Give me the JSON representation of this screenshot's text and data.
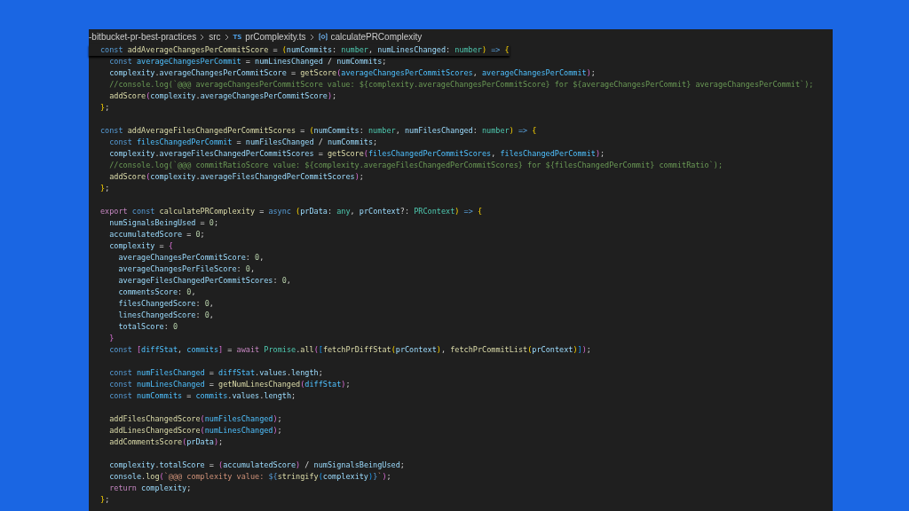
{
  "breadcrumbs": [
    {
      "label": "-bitbucket-pr-best-practices",
      "kind": "folder"
    },
    {
      "label": "src",
      "kind": "folder"
    },
    {
      "label": "prComplexity.ts",
      "kind": "file",
      "icon_text": "TS"
    },
    {
      "label": "calculatePRComplexity",
      "kind": "symbol"
    }
  ],
  "sticky_line": [
    {
      "text": "const ",
      "kind": "kw"
    },
    {
      "text": "addAverageChangesPerCommitScore",
      "kind": "fn"
    },
    {
      "text": " = ",
      "kind": "p"
    },
    {
      "text": "(",
      "kind": "b1"
    },
    {
      "text": "numCommits",
      "kind": "var"
    },
    {
      "text": ": ",
      "kind": "p"
    },
    {
      "text": "number",
      "kind": "type"
    },
    {
      "text": ", ",
      "kind": "p"
    },
    {
      "text": "numLinesChanged",
      "kind": "var"
    },
    {
      "text": ": ",
      "kind": "p"
    },
    {
      "text": "number",
      "kind": "type"
    },
    {
      "text": ")",
      "kind": "b1"
    },
    {
      "text": " => ",
      "kind": "kw"
    },
    {
      "text": "{",
      "kind": "b1"
    }
  ],
  "blocks": [
    [
      [
        {
          "text": "  const ",
          "kind": "kw"
        },
        {
          "text": "averageChangesPerCommit",
          "kind": "cvar"
        },
        {
          "text": " = ",
          "kind": "p"
        },
        {
          "text": "numLinesChanged",
          "kind": "var"
        },
        {
          "text": " / ",
          "kind": "p"
        },
        {
          "text": "numCommits",
          "kind": "var"
        },
        {
          "text": ";",
          "kind": "p"
        }
      ],
      [
        {
          "text": "  complexity",
          "kind": "var"
        },
        {
          "text": ".",
          "kind": "p"
        },
        {
          "text": "averageChangesPerCommitScore",
          "kind": "var"
        },
        {
          "text": " = ",
          "kind": "p"
        },
        {
          "text": "getScore",
          "kind": "fn"
        },
        {
          "text": "(",
          "kind": "b2"
        },
        {
          "text": "averageChangesPerCommitScores",
          "kind": "cvar"
        },
        {
          "text": ", ",
          "kind": "p"
        },
        {
          "text": "averageChangesPerCommit",
          "kind": "cvar"
        },
        {
          "text": ")",
          "kind": "b2"
        },
        {
          "text": ";",
          "kind": "p"
        }
      ],
      [
        {
          "text": "  //console.log(`@@@ averageChangesPerCommitScore value: ${complexity.averageChangesPerCommitScore} for ${averageChangesPerCommit} averageChangesPerCommit`);",
          "kind": "cm"
        }
      ],
      [
        {
          "text": "  addScore",
          "kind": "fn"
        },
        {
          "text": "(",
          "kind": "b2"
        },
        {
          "text": "complexity",
          "kind": "var"
        },
        {
          "text": ".",
          "kind": "p"
        },
        {
          "text": "averageChangesPerCommitScore",
          "kind": "var"
        },
        {
          "text": ")",
          "kind": "b2"
        },
        {
          "text": ";",
          "kind": "p"
        }
      ],
      [
        {
          "text": "}",
          "kind": "b1"
        },
        {
          "text": ";",
          "kind": "p"
        }
      ]
    ],
    [
      [
        {
          "text": "const ",
          "kind": "kw"
        },
        {
          "text": "addAverageFilesChangedPerCommitScores",
          "kind": "fn"
        },
        {
          "text": " = ",
          "kind": "p"
        },
        {
          "text": "(",
          "kind": "b1"
        },
        {
          "text": "numCommits",
          "kind": "var"
        },
        {
          "text": ": ",
          "kind": "p"
        },
        {
          "text": "number",
          "kind": "type"
        },
        {
          "text": ", ",
          "kind": "p"
        },
        {
          "text": "numFilesChanged",
          "kind": "var"
        },
        {
          "text": ": ",
          "kind": "p"
        },
        {
          "text": "number",
          "kind": "type"
        },
        {
          "text": ")",
          "kind": "b1"
        },
        {
          "text": " => ",
          "kind": "kw"
        },
        {
          "text": "{",
          "kind": "b1"
        }
      ],
      [
        {
          "text": "  const ",
          "kind": "kw"
        },
        {
          "text": "filesChangedPerCommit",
          "kind": "cvar"
        },
        {
          "text": " = ",
          "kind": "p"
        },
        {
          "text": "numFilesChanged",
          "kind": "var"
        },
        {
          "text": " / ",
          "kind": "p"
        },
        {
          "text": "numCommits",
          "kind": "var"
        },
        {
          "text": ";",
          "kind": "p"
        }
      ],
      [
        {
          "text": "  complexity",
          "kind": "var"
        },
        {
          "text": ".",
          "kind": "p"
        },
        {
          "text": "averageFilesChangedPerCommitScores",
          "kind": "var"
        },
        {
          "text": " = ",
          "kind": "p"
        },
        {
          "text": "getScore",
          "kind": "fn"
        },
        {
          "text": "(",
          "kind": "b2"
        },
        {
          "text": "filesChangedPerCommitScores",
          "kind": "cvar"
        },
        {
          "text": ", ",
          "kind": "p"
        },
        {
          "text": "filesChangedPerCommit",
          "kind": "cvar"
        },
        {
          "text": ")",
          "kind": "b2"
        },
        {
          "text": ";",
          "kind": "p"
        }
      ],
      [
        {
          "text": "  //console.log(`@@@ commitRatioScore value: ${complexity.averageFilesChangedPerCommitScores} for ${filesChangedPerCommit} commitRatio`);",
          "kind": "cm"
        }
      ],
      [
        {
          "text": "  addScore",
          "kind": "fn"
        },
        {
          "text": "(",
          "kind": "b2"
        },
        {
          "text": "complexity",
          "kind": "var"
        },
        {
          "text": ".",
          "kind": "p"
        },
        {
          "text": "averageFilesChangedPerCommitScores",
          "kind": "var"
        },
        {
          "text": ")",
          "kind": "b2"
        },
        {
          "text": ";",
          "kind": "p"
        }
      ],
      [
        {
          "text": "}",
          "kind": "b1"
        },
        {
          "text": ";",
          "kind": "p"
        }
      ]
    ],
    [
      [
        {
          "text": "export ",
          "kind": "ctl"
        },
        {
          "text": "const ",
          "kind": "kw"
        },
        {
          "text": "calculatePRComplexity",
          "kind": "fn"
        },
        {
          "text": " = ",
          "kind": "p"
        },
        {
          "text": "async ",
          "kind": "kw"
        },
        {
          "text": "(",
          "kind": "b1"
        },
        {
          "text": "prData",
          "kind": "var"
        },
        {
          "text": ": ",
          "kind": "p"
        },
        {
          "text": "any",
          "kind": "type"
        },
        {
          "text": ", ",
          "kind": "p"
        },
        {
          "text": "prContext",
          "kind": "var"
        },
        {
          "text": "?: ",
          "kind": "p"
        },
        {
          "text": "PRContext",
          "kind": "type"
        },
        {
          "text": ")",
          "kind": "b1"
        },
        {
          "text": " => ",
          "kind": "kw"
        },
        {
          "text": "{",
          "kind": "b1"
        }
      ],
      [
        {
          "text": "  numSignalsBeingUsed",
          "kind": "var"
        },
        {
          "text": " = ",
          "kind": "p"
        },
        {
          "text": "0",
          "kind": "num"
        },
        {
          "text": ";",
          "kind": "p"
        }
      ],
      [
        {
          "text": "  accumulatedScore",
          "kind": "var"
        },
        {
          "text": " = ",
          "kind": "p"
        },
        {
          "text": "0",
          "kind": "num"
        },
        {
          "text": ";",
          "kind": "p"
        }
      ],
      [
        {
          "text": "  complexity",
          "kind": "var"
        },
        {
          "text": " = ",
          "kind": "p"
        },
        {
          "text": "{",
          "kind": "b2"
        }
      ],
      [
        {
          "text": "    averageChangesPerCommitScore",
          "kind": "var"
        },
        {
          "text": ": ",
          "kind": "p"
        },
        {
          "text": "0",
          "kind": "num"
        },
        {
          "text": ",",
          "kind": "p"
        }
      ],
      [
        {
          "text": "    averageChangesPerFileScore",
          "kind": "var"
        },
        {
          "text": ": ",
          "kind": "p"
        },
        {
          "text": "0",
          "kind": "num"
        },
        {
          "text": ",",
          "kind": "p"
        }
      ],
      [
        {
          "text": "    averageFilesChangedPerCommitScores",
          "kind": "var"
        },
        {
          "text": ": ",
          "kind": "p"
        },
        {
          "text": "0",
          "kind": "num"
        },
        {
          "text": ",",
          "kind": "p"
        }
      ],
      [
        {
          "text": "    commentsScore",
          "kind": "var"
        },
        {
          "text": ": ",
          "kind": "p"
        },
        {
          "text": "0",
          "kind": "num"
        },
        {
          "text": ",",
          "kind": "p"
        }
      ],
      [
        {
          "text": "    filesChangedScore",
          "kind": "var"
        },
        {
          "text": ": ",
          "kind": "p"
        },
        {
          "text": "0",
          "kind": "num"
        },
        {
          "text": ",",
          "kind": "p"
        }
      ],
      [
        {
          "text": "    linesChangedScore",
          "kind": "var"
        },
        {
          "text": ": ",
          "kind": "p"
        },
        {
          "text": "0",
          "kind": "num"
        },
        {
          "text": ",",
          "kind": "p"
        }
      ],
      [
        {
          "text": "    totalScore",
          "kind": "var"
        },
        {
          "text": ": ",
          "kind": "p"
        },
        {
          "text": "0",
          "kind": "num"
        }
      ],
      [
        {
          "text": "  }",
          "kind": "b2"
        }
      ],
      [
        {
          "text": "  const ",
          "kind": "kw"
        },
        {
          "text": "[",
          "kind": "b2"
        },
        {
          "text": "diffStat",
          "kind": "cvar"
        },
        {
          "text": ", ",
          "kind": "p"
        },
        {
          "text": "commits",
          "kind": "cvar"
        },
        {
          "text": "]",
          "kind": "b2"
        },
        {
          "text": " = ",
          "kind": "p"
        },
        {
          "text": "await ",
          "kind": "ctl"
        },
        {
          "text": "Promise",
          "kind": "type"
        },
        {
          "text": ".",
          "kind": "p"
        },
        {
          "text": "all",
          "kind": "fn"
        },
        {
          "text": "(",
          "kind": "b2"
        },
        {
          "text": "[",
          "kind": "b3"
        },
        {
          "text": "fetchPrDiffStat",
          "kind": "fn"
        },
        {
          "text": "(",
          "kind": "b1"
        },
        {
          "text": "prContext",
          "kind": "var"
        },
        {
          "text": ")",
          "kind": "b1"
        },
        {
          "text": ", ",
          "kind": "p"
        },
        {
          "text": "fetchPrCommitList",
          "kind": "fn"
        },
        {
          "text": "(",
          "kind": "b1"
        },
        {
          "text": "prContext",
          "kind": "var"
        },
        {
          "text": ")",
          "kind": "b1"
        },
        {
          "text": "]",
          "kind": "b3"
        },
        {
          "text": ")",
          "kind": "b2"
        },
        {
          "text": ";",
          "kind": "p"
        }
      ]
    ],
    [
      [
        {
          "text": "  const ",
          "kind": "kw"
        },
        {
          "text": "numFilesChanged",
          "kind": "cvar"
        },
        {
          "text": " = ",
          "kind": "p"
        },
        {
          "text": "diffStat",
          "kind": "cvar"
        },
        {
          "text": ".",
          "kind": "p"
        },
        {
          "text": "values",
          "kind": "var"
        },
        {
          "text": ".",
          "kind": "p"
        },
        {
          "text": "length",
          "kind": "var"
        },
        {
          "text": ";",
          "kind": "p"
        }
      ],
      [
        {
          "text": "  const ",
          "kind": "kw"
        },
        {
          "text": "numLinesChanged",
          "kind": "cvar"
        },
        {
          "text": " = ",
          "kind": "p"
        },
        {
          "text": "getNumLinesChanged",
          "kind": "fn"
        },
        {
          "text": "(",
          "kind": "b2"
        },
        {
          "text": "diffStat",
          "kind": "cvar"
        },
        {
          "text": ")",
          "kind": "b2"
        },
        {
          "text": ";",
          "kind": "p"
        }
      ],
      [
        {
          "text": "  const ",
          "kind": "kw"
        },
        {
          "text": "numCommits",
          "kind": "cvar"
        },
        {
          "text": " = ",
          "kind": "p"
        },
        {
          "text": "commits",
          "kind": "cvar"
        },
        {
          "text": ".",
          "kind": "p"
        },
        {
          "text": "values",
          "kind": "var"
        },
        {
          "text": ".",
          "kind": "p"
        },
        {
          "text": "length",
          "kind": "var"
        },
        {
          "text": ";",
          "kind": "p"
        }
      ]
    ],
    [
      [
        {
          "text": "  addFilesChangedScore",
          "kind": "fn"
        },
        {
          "text": "(",
          "kind": "b2"
        },
        {
          "text": "numFilesChanged",
          "kind": "cvar"
        },
        {
          "text": ")",
          "kind": "b2"
        },
        {
          "text": ";",
          "kind": "p"
        }
      ],
      [
        {
          "text": "  addLinesChangedScore",
          "kind": "fn"
        },
        {
          "text": "(",
          "kind": "b2"
        },
        {
          "text": "numLinesChanged",
          "kind": "cvar"
        },
        {
          "text": ")",
          "kind": "b2"
        },
        {
          "text": ";",
          "kind": "p"
        }
      ],
      [
        {
          "text": "  addCommentsScore",
          "kind": "fn"
        },
        {
          "text": "(",
          "kind": "b2"
        },
        {
          "text": "prData",
          "kind": "var"
        },
        {
          "text": ")",
          "kind": "b2"
        },
        {
          "text": ";",
          "kind": "p"
        }
      ]
    ],
    [
      [
        {
          "text": "  complexity",
          "kind": "var"
        },
        {
          "text": ".",
          "kind": "p"
        },
        {
          "text": "totalScore",
          "kind": "var"
        },
        {
          "text": " = ",
          "kind": "p"
        },
        {
          "text": "(",
          "kind": "b2"
        },
        {
          "text": "accumulatedScore",
          "kind": "var"
        },
        {
          "text": ")",
          "kind": "b2"
        },
        {
          "text": " / ",
          "kind": "p"
        },
        {
          "text": "numSignalsBeingUsed",
          "kind": "var"
        },
        {
          "text": ";",
          "kind": "p"
        }
      ],
      [
        {
          "text": "  console",
          "kind": "var"
        },
        {
          "text": ".",
          "kind": "p"
        },
        {
          "text": "log",
          "kind": "fn"
        },
        {
          "text": "(",
          "kind": "b2"
        },
        {
          "text": "`@@@ complexity value: ",
          "kind": "str"
        },
        {
          "text": "${",
          "kind": "kw"
        },
        {
          "text": "stringify",
          "kind": "fn"
        },
        {
          "text": "(",
          "kind": "b3"
        },
        {
          "text": "complexity",
          "kind": "var"
        },
        {
          "text": ")",
          "kind": "b3"
        },
        {
          "text": "}",
          "kind": "kw"
        },
        {
          "text": "`",
          "kind": "str"
        },
        {
          "text": ")",
          "kind": "b2"
        },
        {
          "text": ";",
          "kind": "p"
        }
      ],
      [
        {
          "text": "  return ",
          "kind": "ctl"
        },
        {
          "text": "complexity",
          "kind": "var"
        },
        {
          "text": ";",
          "kind": "p"
        }
      ],
      [
        {
          "text": "}",
          "kind": "b1"
        },
        {
          "text": ";",
          "kind": "p"
        }
      ]
    ]
  ]
}
